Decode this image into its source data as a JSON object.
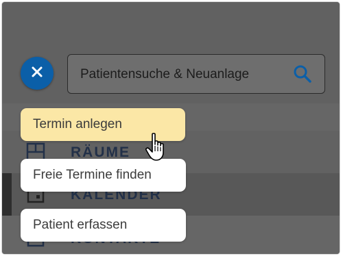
{
  "search": {
    "placeholder": "Patientensuche & Neuanlage",
    "icon": "search-icon"
  },
  "close_button": {
    "icon": "close-icon",
    "color": "#0b5fa8"
  },
  "nav": {
    "items": [
      {
        "label": "RÄUME",
        "icon": "rooms-icon"
      },
      {
        "label": "KALENDER",
        "icon": "calendar-icon"
      },
      {
        "label": "KONTAKTE",
        "icon": "contacts-icon"
      }
    ]
  },
  "actions": [
    {
      "label": "Termin anlegen",
      "highlight_color": "#fbe7a6"
    },
    {
      "label": "Freie Termine finden"
    },
    {
      "label": "Patient erfassen"
    }
  ]
}
